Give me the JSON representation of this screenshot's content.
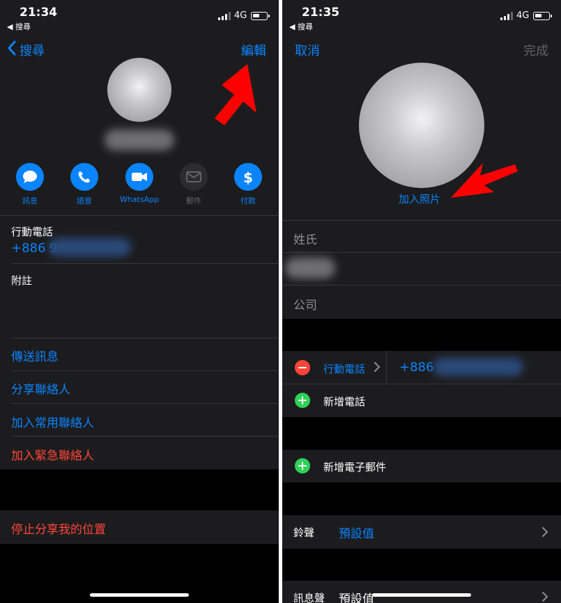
{
  "left": {
    "status": {
      "time": "21:34",
      "back_app": "◀ 搜尋",
      "network": "4G"
    },
    "nav": {
      "back_label": "搜尋",
      "edit_label": "編輯"
    },
    "actions": [
      {
        "label": "訊息",
        "icon": "message-icon",
        "enabled": true
      },
      {
        "label": "語音",
        "icon": "phone-icon",
        "enabled": true
      },
      {
        "label": "WhatsApp",
        "icon": "video-icon",
        "enabled": true
      },
      {
        "label": "郵件",
        "icon": "mail-icon",
        "enabled": false
      },
      {
        "label": "付款",
        "icon": "dollar-icon",
        "enabled": true
      }
    ],
    "phone": {
      "label": "行動電話",
      "value": "+886 9"
    },
    "notes_label": "附註",
    "links": {
      "send_message": "傳送訊息",
      "share_contact": "分享聯絡人",
      "add_favorites": "加入常用聯絡人",
      "add_emergency": "加入緊急聯絡人",
      "stop_sharing": "停止分享我的位置"
    }
  },
  "right": {
    "status": {
      "time": "21:35",
      "back_app": "◀ 搜尋",
      "network": "4G"
    },
    "nav": {
      "cancel_label": "取消",
      "done_label": "完成"
    },
    "add_photo_label": "加入照片",
    "fields": {
      "last_name_placeholder": "姓氏",
      "company_placeholder": "公司"
    },
    "phone": {
      "type_label": "行動電話",
      "value": "+886"
    },
    "add_phone_label": "新增電話",
    "add_email_label": "新增電子郵件",
    "ringtone": {
      "label": "鈴聲",
      "value": "預設值"
    },
    "text_tone": {
      "label": "訊息聲",
      "value": "預設值"
    }
  },
  "colors": {
    "accent_blue": "#0a84ff",
    "destructive_red": "#ff453a",
    "add_green": "#30d158",
    "annotation_arrow": "#ff0000"
  }
}
